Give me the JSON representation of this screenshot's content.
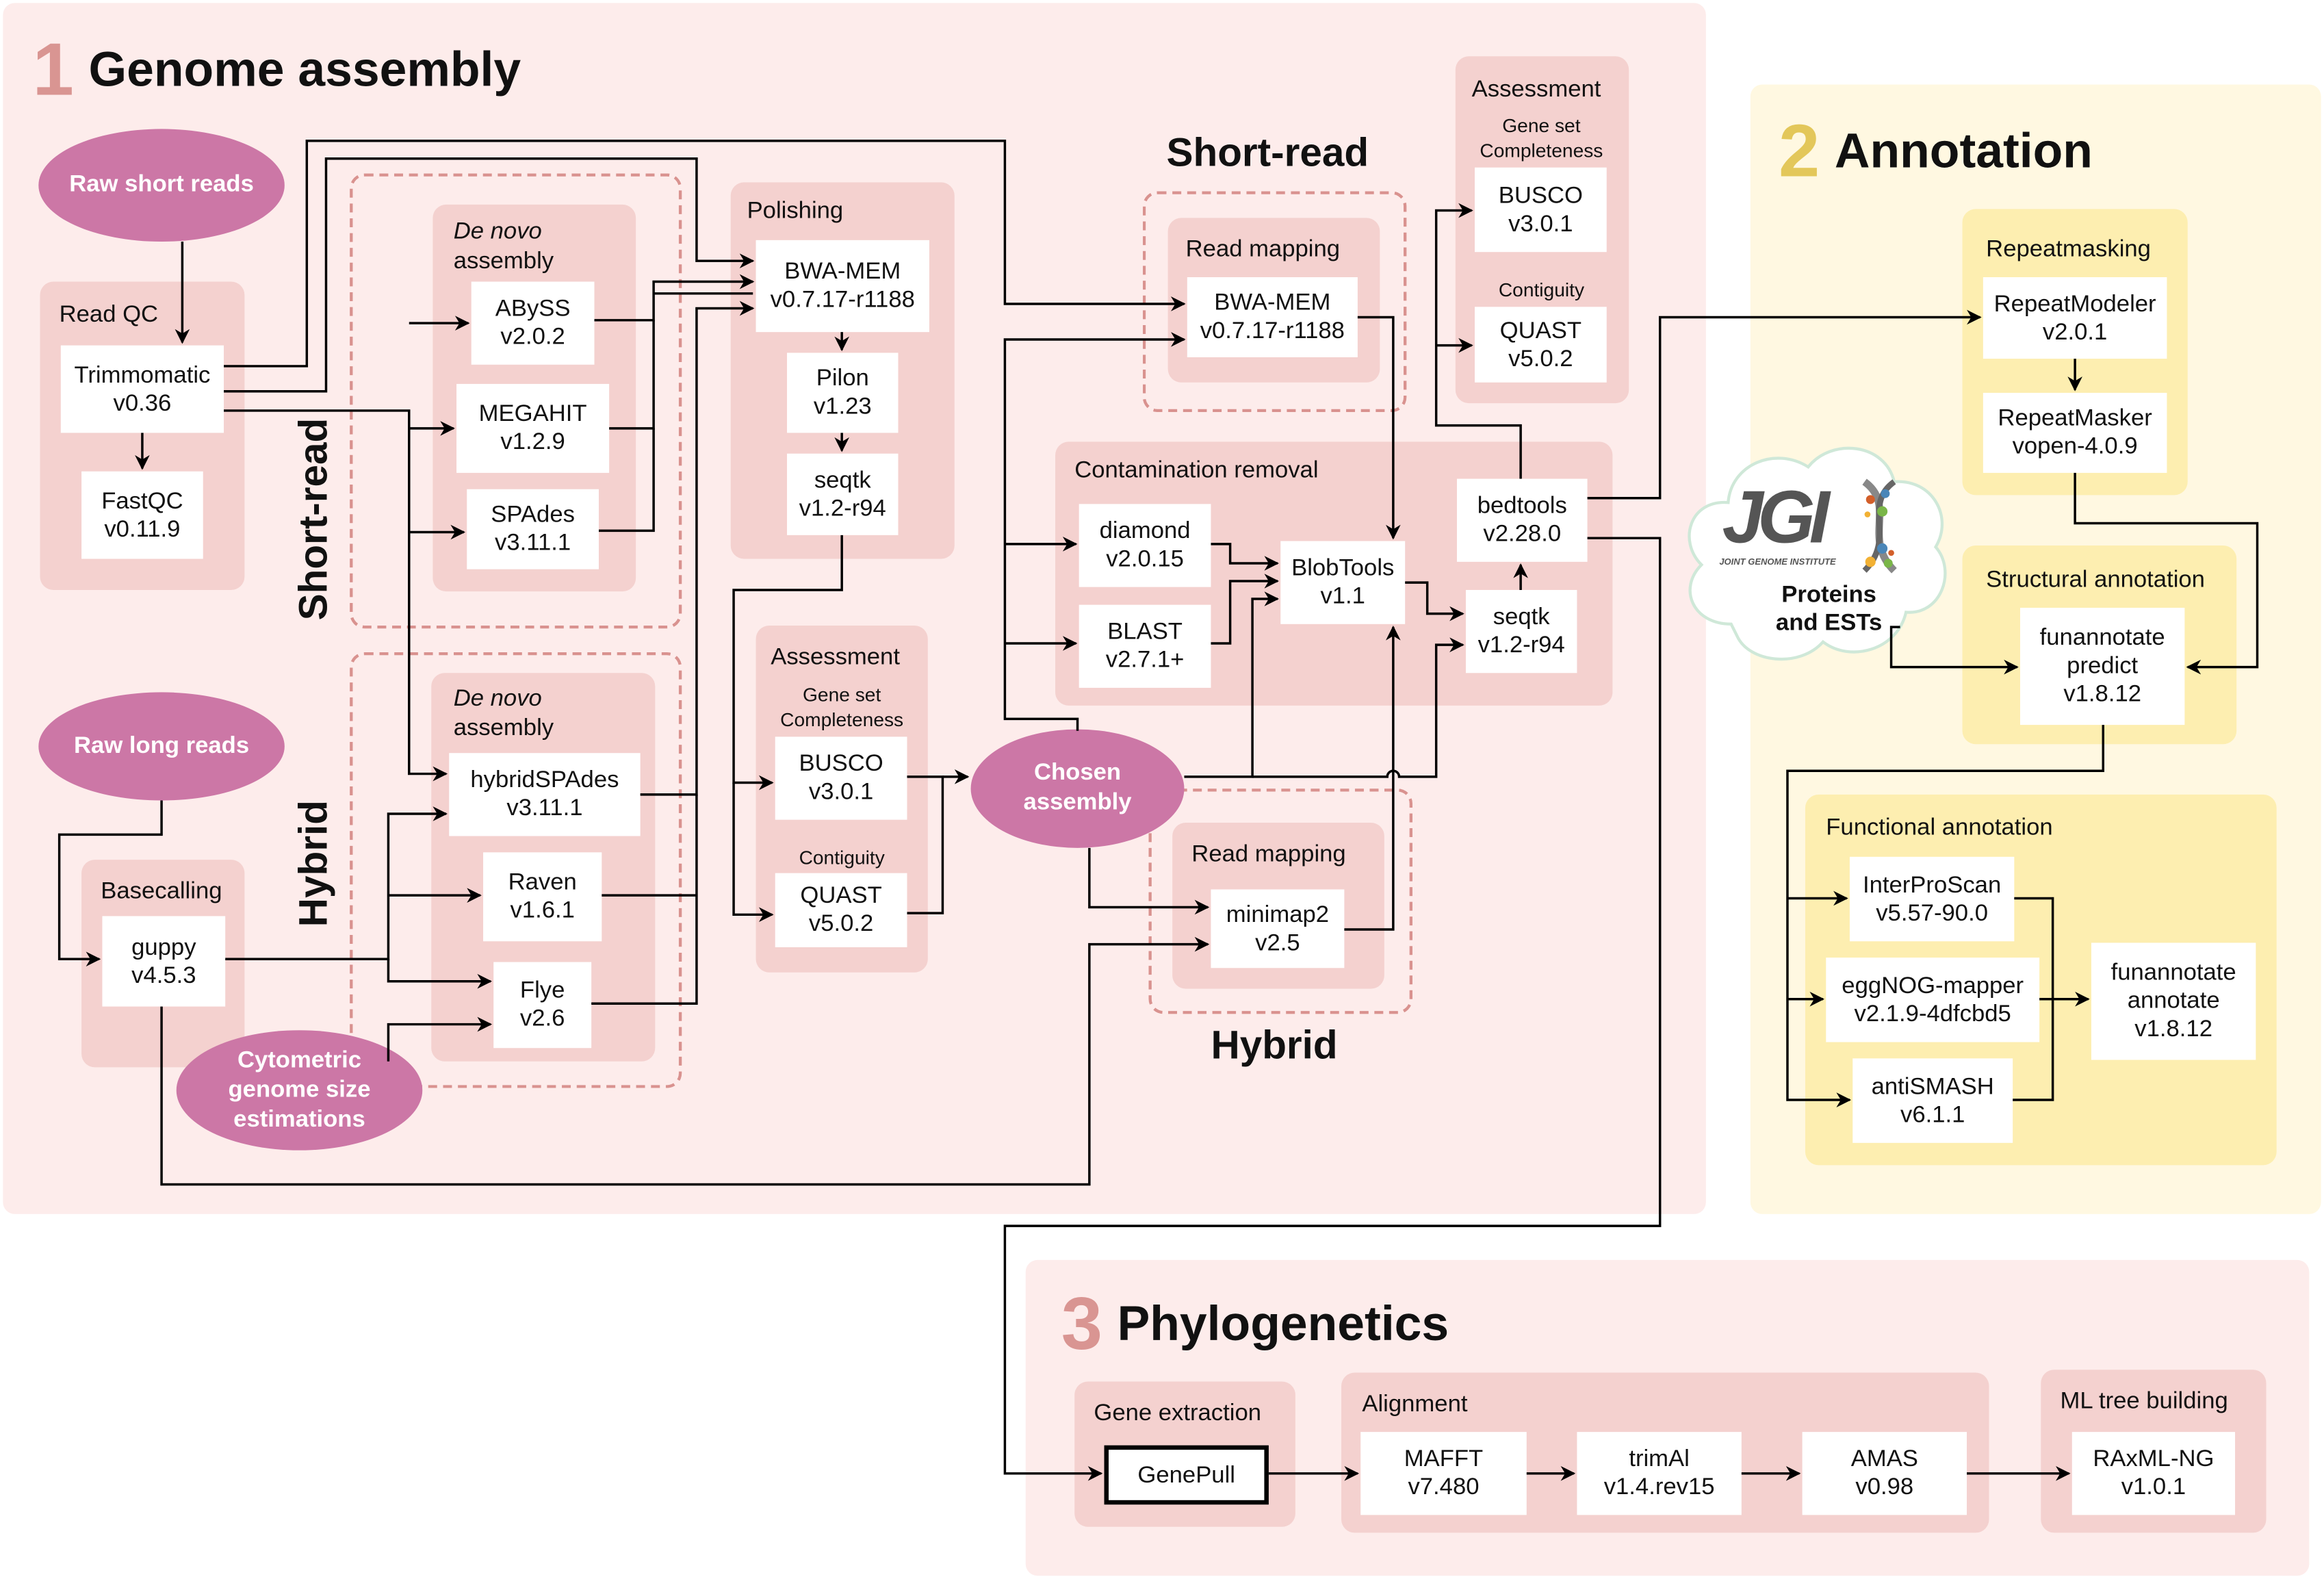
{
  "sections": {
    "genome_assembly": {
      "number": "1",
      "title": "Genome assembly",
      "number_color": "#d99592"
    },
    "annotation": {
      "number": "2",
      "title": "Annotation",
      "number_color": "#e3c75a"
    },
    "phylogenetics": {
      "number": "3",
      "title": "Phylogenetics",
      "number_color": "#d99592"
    }
  },
  "inputs": {
    "raw_short_reads": "Raw short reads",
    "raw_long_reads": "Raw long reads",
    "cytometric": "Cytometric genome size estimations",
    "chosen_assembly": "Chosen assembly"
  },
  "track_labels": {
    "short_read_vertical": "Short-read",
    "hybrid_vertical": "Hybrid",
    "short_read_mapping": "Short-read",
    "hybrid_mapping": "Hybrid"
  },
  "groups": {
    "read_qc": "Read QC",
    "de_novo_short": {
      "italic": "De novo",
      "rest": "assembly"
    },
    "de_novo_hybrid": {
      "italic": "De novo",
      "rest": "assembly"
    },
    "basecalling": "Basecalling",
    "polishing": "Polishing",
    "assessment_mid": {
      "title": "Assessment",
      "completeness": "Gene set Completeness",
      "contiguity": "Contiguity"
    },
    "assessment_top": {
      "title": "Assessment",
      "completeness": "Gene set Completeness",
      "contiguity": "Contiguity"
    },
    "read_mapping_short": "Read mapping",
    "read_mapping_hybrid": "Read mapping",
    "contamination_removal": "Contamination removal",
    "repeatmasking": "Repeatmasking",
    "structural_annotation": "Structural annotation",
    "functional_annotation": "Functional annotation",
    "gene_extraction": "Gene extraction",
    "alignment": "Alignment",
    "ml_tree_building": "ML tree building"
  },
  "tools": {
    "trimmomatic": {
      "name": "Trimmomatic",
      "version": "v0.36"
    },
    "fastqc": {
      "name": "FastQC",
      "version": "v0.11.9"
    },
    "abyss": {
      "name": "ABySS",
      "version": "v2.0.2"
    },
    "megahit": {
      "name": "MEGAHIT",
      "version": "v1.2.9"
    },
    "spades": {
      "name": "SPAdes",
      "version": "v3.11.1"
    },
    "hybridspades": {
      "name": "hybridSPAdes",
      "version": "v3.11.1"
    },
    "raven": {
      "name": "Raven",
      "version": "v1.6.1"
    },
    "flye": {
      "name": "Flye",
      "version": "v2.6"
    },
    "guppy": {
      "name": "guppy",
      "version": "v4.5.3"
    },
    "bwa_polish": {
      "name": "BWA-MEM",
      "version": "v0.7.17-r1188"
    },
    "pilon": {
      "name": "Pilon",
      "version": "v1.23"
    },
    "seqtk_polish": {
      "name": "seqtk",
      "version": "v1.2-r94"
    },
    "busco_mid": {
      "name": "BUSCO",
      "version": "v3.0.1"
    },
    "quast_mid": {
      "name": "QUAST",
      "version": "v5.0.2"
    },
    "bwa_map": {
      "name": "BWA-MEM",
      "version": "v0.7.17-r1188"
    },
    "minimap2": {
      "name": "minimap2",
      "version": "v2.5"
    },
    "diamond": {
      "name": "diamond",
      "version": "v2.0.15"
    },
    "blast": {
      "name": "BLAST",
      "version": "v2.7.1+"
    },
    "blobtools": {
      "name": "BlobTools",
      "version": "v1.1"
    },
    "seqtk_cont": {
      "name": "seqtk",
      "version": "v1.2-r94"
    },
    "bedtools": {
      "name": "bedtools",
      "version": "v2.28.0"
    },
    "busco_top": {
      "name": "BUSCO",
      "version": "v3.0.1"
    },
    "quast_top": {
      "name": "QUAST",
      "version": "v5.0.2"
    },
    "repeatmodeler": {
      "name": "RepeatModeler",
      "version": "v2.0.1"
    },
    "repeatmasker": {
      "name": "RepeatMasker",
      "version": "vopen-4.0.9"
    },
    "funannotate_predict": {
      "name": "funannotate",
      "mid": "predict",
      "version": "v1.8.12"
    },
    "interproscan": {
      "name": "InterProScan",
      "version": "v5.57-90.0"
    },
    "eggnog": {
      "name": "eggNOG-mapper",
      "version": "v2.1.9-4dfcbd5"
    },
    "antismash": {
      "name": "antiSMASH",
      "version": "v6.1.1"
    },
    "funannotate_annotate": {
      "name": "funannotate",
      "mid": "annotate",
      "version": "v1.8.12"
    },
    "genepull": {
      "name": "GenePull"
    },
    "mafft": {
      "name": "MAFFT",
      "version": "v7.480"
    },
    "trimal": {
      "name": "trimAl",
      "version": "v1.4.rev15"
    },
    "amas": {
      "name": "AMAS",
      "version": "v0.98"
    },
    "raxml": {
      "name": "RAxML-NG",
      "version": "v1.0.1"
    }
  },
  "jgi": {
    "logo_text": "JGI",
    "logo_subtitle": "JOINT GENOME INSTITUTE",
    "label_line1": "Proteins",
    "label_line2": "and ESTs"
  }
}
